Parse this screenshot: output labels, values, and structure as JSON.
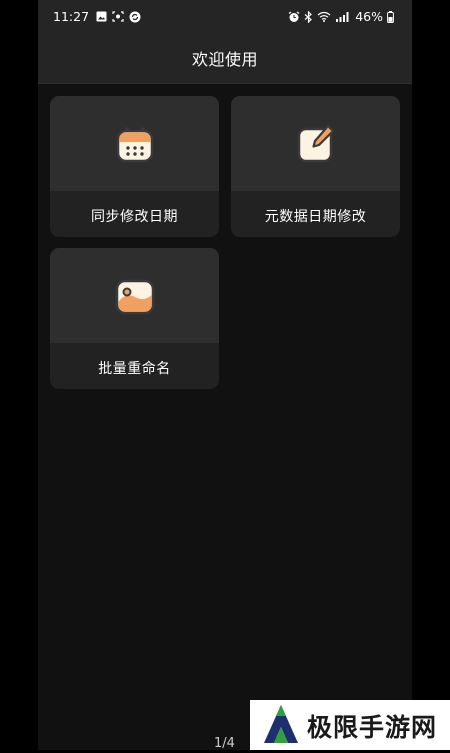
{
  "status_bar": {
    "time": "11:27",
    "battery": "46%",
    "left_icons": [
      "image-icon",
      "screenshot-icon",
      "sync-icon"
    ],
    "right_icons": [
      "alarm-icon",
      "bluetooth-icon",
      "wifi-icon",
      "signal-icon",
      "battery-icon"
    ]
  },
  "app_bar": {
    "title": "欢迎使用"
  },
  "cards": [
    {
      "label": "同步修改日期",
      "icon": "calendar-icon"
    },
    {
      "label": "元数据日期修改",
      "icon": "edit-icon"
    },
    {
      "label": "批量重命名",
      "icon": "gallery-icon"
    }
  ],
  "pager": {
    "text": "1/4"
  },
  "watermark": {
    "text": "极限手游网"
  },
  "colors": {
    "background": "#111111",
    "bar": "#252525",
    "card": "#222222",
    "card_top": "#2e2e2e",
    "accent_orange": "#f0a060",
    "icon_cream": "#fdf3e3",
    "icon_outline": "#3a3a3a"
  }
}
